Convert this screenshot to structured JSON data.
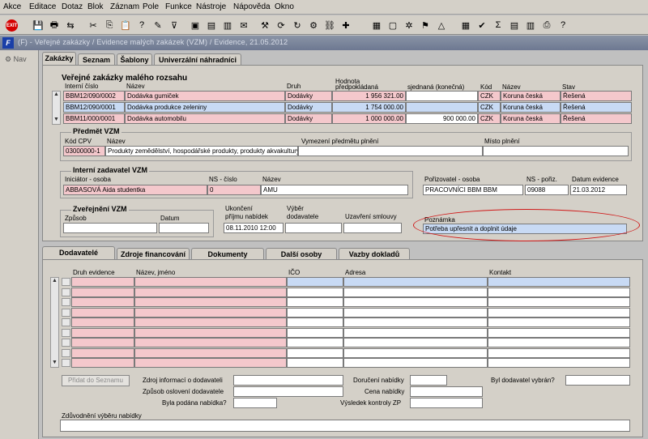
{
  "menu": [
    "Akce",
    "Editace",
    "Dotaz",
    "Blok",
    "Záznam",
    "Pole",
    "Funkce",
    "Nástroje",
    "Nápověda",
    "Okno"
  ],
  "toolbar": {
    "exit_label": "EXIT"
  },
  "window": {
    "app_icon": "F",
    "title": "(F) - Veřejné zakázky / Evidence malých zakázek (VZM) / Evidence, 21.05.2012"
  },
  "leftnav": {
    "label": "Nav"
  },
  "tabs": [
    "Zakázky",
    "Seznam",
    "Šablony",
    "Univerzální náhradníci"
  ],
  "section": {
    "title": "Veřejné zakázky malého rozsahu"
  },
  "list_headers": {
    "interni": "Interní číslo",
    "nazev": "Název",
    "druh": "Druh",
    "hodnota": "Hodnota",
    "predpokladana": "předpokládaná",
    "sjednana": "sjednaná (konečná)",
    "kod": "Kód",
    "mena_nazev": "Název",
    "stav": "Stav"
  },
  "list_rows": [
    {
      "interni": "BBM12/090/0002",
      "nazev": "Dodávka gumiček",
      "druh": "Dodávky",
      "predpokladana": "1 956 321.00",
      "sjednana": "",
      "kod": "CZK",
      "mena": "Koruna česká",
      "stav": "Řešená"
    },
    {
      "interni": "BBM12/090/0001",
      "nazev": "Dodávka produkce zeleniny",
      "druh": "Dodávky",
      "predpokladana": "1 754 000.00",
      "sjednana": "",
      "kod": "CZK",
      "mena": "Koruna česká",
      "stav": "Řešená"
    },
    {
      "interni": "BBM11/000/0001",
      "nazev": "Dodávka automobilu",
      "druh": "Dodávky",
      "predpokladana": "1 000 000.00",
      "sjednana": "900 000.00",
      "kod": "CZK",
      "mena": "Koruna česká",
      "stav": "Řešená"
    }
  ],
  "predmet": {
    "title": "Předmět VZM",
    "kod_cpv_label": "Kód CPV",
    "nazev_label": "Název",
    "vymezeni_label": "Vymezení předmětu plnění",
    "misto_label": "Místo plnění",
    "kod_cpv": "03000000-1",
    "nazev": "Produkty zemědělství, hospodářské produkty, produkty akvakultury",
    "vymezeni": "",
    "misto": ""
  },
  "interni_zadavatel": {
    "title": "Interní zadavatel VZM",
    "iniciator_label": "Iniciátor - osoba",
    "ns_label": "NS - číslo",
    "nazev_label": "Název",
    "iniciator": "ABBASOVÁ Aida studentka",
    "ns": "0",
    "nazev": "AMU"
  },
  "porizovatel": {
    "osoba_label": "Pořizovatel - osoba",
    "ns_label": "NS - pořiz.",
    "datum_label": "Datum evidence",
    "osoba": "PRACOVNÍCI BBM BBM",
    "ns": "09088",
    "datum": "21.03.2012"
  },
  "zverejneni": {
    "title": "Zveřejnění VZM",
    "zpusob_label": "Způsob",
    "datum_label": "Datum",
    "zpusob": "",
    "datum": ""
  },
  "ukonceni": {
    "label1": "Ukončení",
    "label2": "příjmu nabídek",
    "value": "08.11.2010 12:00"
  },
  "vyber": {
    "label1": "Výběr",
    "label2": "dodavatele",
    "value": ""
  },
  "uzavreni": {
    "label": "Uzavření smlouvy",
    "value": ""
  },
  "poznamka": {
    "label": "Poznámka",
    "value": "Potřeba upřesnit a doplnit údaje"
  },
  "lower_tabs": [
    "Dodavatelé",
    "Zdroje financování",
    "Dokumenty",
    "Další osoby",
    "Vazby dokladů"
  ],
  "dod_headers": {
    "druh": "Druh evidence",
    "nazev": "Název, jméno",
    "ico": "IČO",
    "adresa": "Adresa",
    "kontakt": "Kontakt"
  },
  "dod_rows": 9,
  "form": {
    "pridat_label": "Přidat do Seznamu",
    "zdroj_label": "Zdroj informací o dodavateli",
    "zpusob_label": "Způsob oslovení dodavatele",
    "podana_label": "Byla podána nabídka?",
    "doruceni_label": "Doručení nabídky",
    "cena_label": "Cena nabídky",
    "vysledek_label": "Výsledek kontroly ZP",
    "vybran_label": "Byl dodavatel vybrán?",
    "zduvodneni_label": "Zdůvodnění výběru nabídky"
  }
}
